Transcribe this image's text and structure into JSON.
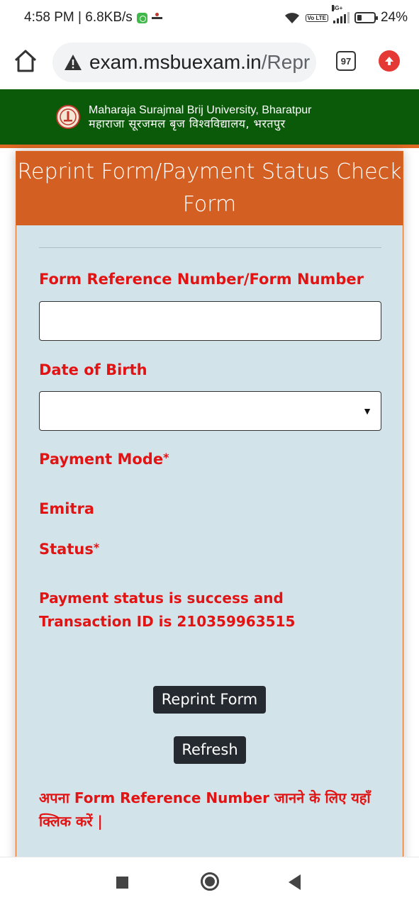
{
  "status_bar": {
    "time_speed": "4:58 PM | 6.8KB/s",
    "volte": "Vo LTE",
    "network": "4G+",
    "battery": "24%"
  },
  "browser": {
    "url_host": "exam.msbuexam.in",
    "url_path": "/Repr",
    "tab_count": "97"
  },
  "header": {
    "university_en": "Maharaja Surajmal Brij University, Bharatpur",
    "university_hi": "महाराजा सूरजमल बृज विश्वविद्यालय, भरतपुर"
  },
  "form": {
    "title": "Reprint Form/Payment Status Check Form",
    "ref_label": "Form Reference Number/Form Number",
    "ref_value": "",
    "dob_label": "Date of Birth",
    "dob_value": "",
    "payment_mode_label": "Payment Mode",
    "required_mark": "*",
    "payment_mode_value": "Emitra",
    "status_label": "Status",
    "status_message": "Payment status is success and Transaction ID is 210359963515",
    "reprint_button": "Reprint Form",
    "refresh_button": "Refresh",
    "help_link": "अपना Form Reference Number जानने के लिए यहाँ क्लिक करें |"
  },
  "colors": {
    "header_green": "#0a5a0a",
    "accent_orange": "#d45f23",
    "card_bg": "#d3e3ea",
    "label_red": "#e21313",
    "button_dark": "#252a30"
  }
}
